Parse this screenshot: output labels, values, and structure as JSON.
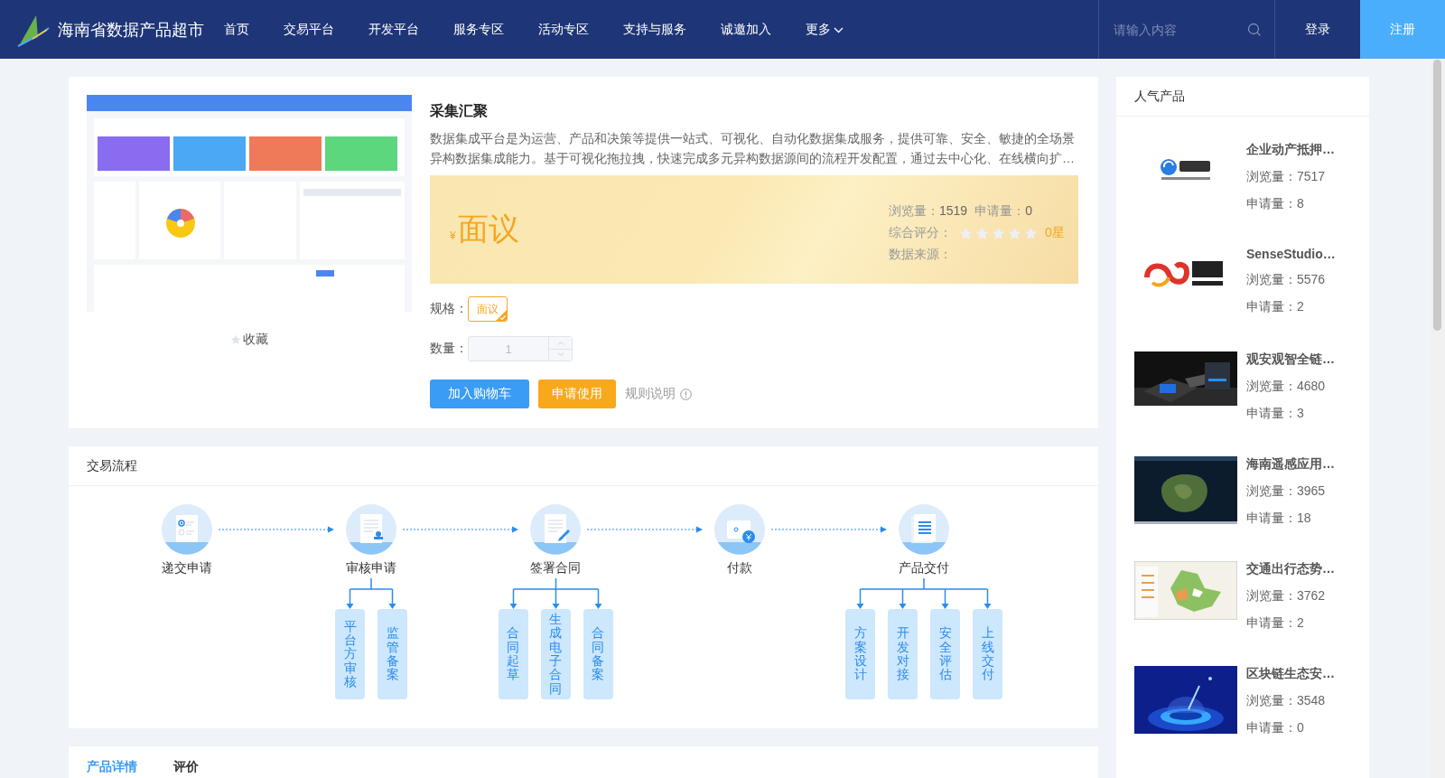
{
  "header": {
    "site_title": "海南省数据产品超市",
    "nav": [
      {
        "label": "首页",
        "has_menu": false
      },
      {
        "label": "交易平台",
        "has_menu": false
      },
      {
        "label": "开发平台",
        "has_menu": false
      },
      {
        "label": "服务专区",
        "has_menu": false
      },
      {
        "label": "活动专区",
        "has_menu": false
      },
      {
        "label": "支持与服务",
        "has_menu": false
      },
      {
        "label": "诚邀加入",
        "has_menu": false
      },
      {
        "label": "更多",
        "has_menu": true
      }
    ],
    "search": {
      "placeholder": "请输入内容"
    },
    "login": "登录",
    "register": "注册"
  },
  "product": {
    "favorite": "收藏",
    "title": "采集汇聚",
    "description": "数据集成平台是为运营、产品和决策等提供一站式、可视化、自动化数据集成服务，提供可靠、安全、敏捷的全场景异构数据集成能力。基于可视化拖拉拽，快速完成多元异构数据源间的流程开发配置，通过去中心化、在线横向扩…",
    "price_symbol": "¥",
    "price": "面议",
    "stats": {
      "views_label": "浏览量：",
      "views": "1519",
      "applies_label": "申请量：",
      "applies": "0",
      "rating_label": "综合评分：",
      "stars": 0,
      "rating_text": "0星",
      "source_label": "数据来源："
    },
    "spec_label": "规格：",
    "specs": [
      {
        "label": "面议",
        "selected": true
      }
    ],
    "quantity_label": "数量：",
    "quantity": "1",
    "buttons": [
      {
        "label": "加入购物车",
        "kind": "primary"
      },
      {
        "label": "申请使用",
        "kind": "warning"
      }
    ],
    "rules_link": "规则说明"
  },
  "flow": {
    "title": "交易流程",
    "steps": [
      {
        "label": "递交申请"
      },
      {
        "label": "审核申请",
        "children": [
          "平台方审核",
          "监管备案"
        ]
      },
      {
        "label": "签署合同",
        "children": [
          "合同起草",
          "生成电子合同",
          "合同备案"
        ]
      },
      {
        "label": "付款"
      },
      {
        "label": "产品交付",
        "children": [
          "方案设计",
          "开发对接",
          "安全评估",
          "上线交付"
        ]
      }
    ]
  },
  "tabs": [
    {
      "label": "产品详情",
      "selected": true
    },
    {
      "label": "评价",
      "selected": false
    }
  ],
  "sidebar": {
    "title": "人气产品",
    "items": [
      {
        "title": "企业动产抵押…",
        "views": "浏览量：7517",
        "applies": "申请量：8"
      },
      {
        "title": "SenseStudio…",
        "views": "浏览量：5576",
        "applies": "申请量：2"
      },
      {
        "title": "观安观智全链…",
        "views": "浏览量：4680",
        "applies": "申请量：3"
      },
      {
        "title": "海南遥感应用…",
        "views": "浏览量：3965",
        "applies": "申请量：18"
      },
      {
        "title": "交通出行态势…",
        "views": "浏览量：3762",
        "applies": "申请量：2"
      },
      {
        "title": "区块链生态安…",
        "views": "浏览量：3548",
        "applies": "申请量：0"
      }
    ]
  }
}
